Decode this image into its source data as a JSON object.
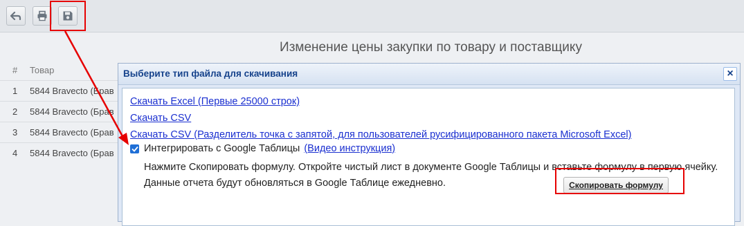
{
  "toolbar": {
    "buttons": [
      {
        "icon": "back-arrow-icon"
      },
      {
        "icon": "print-icon"
      },
      {
        "icon": "save-icon"
      }
    ]
  },
  "page": {
    "title": "Изменение цены закупки по товару и поставщику"
  },
  "table": {
    "headers": [
      "#",
      "Товар"
    ],
    "rows": [
      {
        "num": "1",
        "name": "5844 Bravecto (Брав"
      },
      {
        "num": "2",
        "name": "5844 Bravecto (Брав"
      },
      {
        "num": "3",
        "name": "5844 Bravecto (Брав"
      },
      {
        "num": "4",
        "name": "5844 Bravecto (Брав"
      }
    ]
  },
  "dialog": {
    "title": "Выберите тип файла для скачивания",
    "close_label": "×",
    "links": [
      "Скачать Excel (Первые 25000 строк)",
      "Скачать CSV",
      "Скачать CSV (Разделитель точка с запятой, для пользователей русифицированного пакета Microsoft Excel)"
    ],
    "google_checkbox": {
      "checked": true,
      "label": "Интегрировать с Google Таблицы",
      "video_link": "(Видео инструкция)"
    },
    "instructions": "Нажмите Скопировать формулу. Откройте чистый лист в документе Google Таблицы и вставьте формулу в первую ячейку. Данные отчета будут обновляться в Google Таблице ежедневно.",
    "copy_button": "Скопировать формулу"
  },
  "colors": {
    "highlight": "#e60000",
    "link": "#1a2fd0",
    "dialog_title": "#15428b"
  }
}
